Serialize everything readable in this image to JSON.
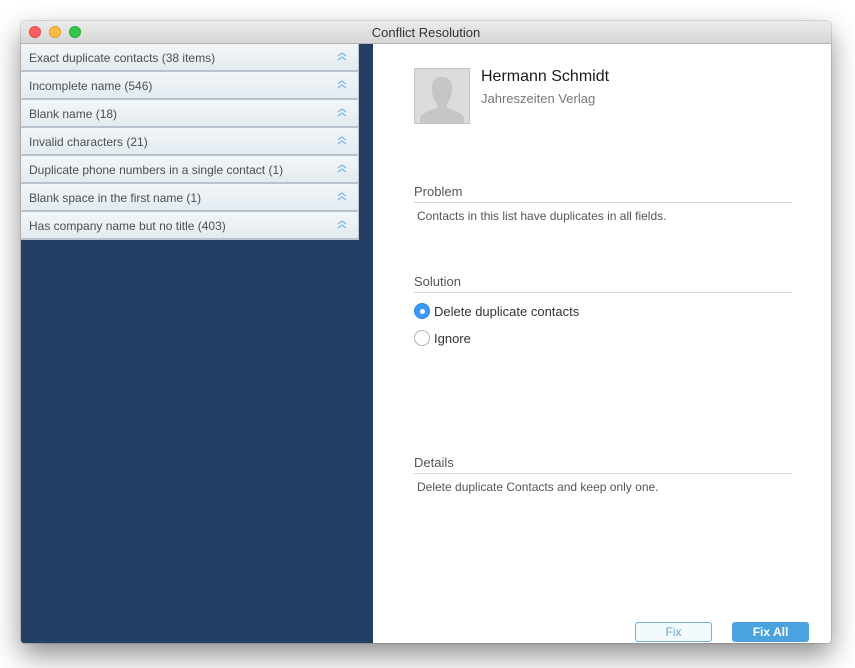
{
  "window": {
    "title": "Conflict Resolution",
    "traffic_lights": [
      "close",
      "minimize",
      "maximize"
    ]
  },
  "sidebar": {
    "background": "#243f63",
    "items": [
      {
        "label": "Exact duplicate contacts (38 items)",
        "icon": "double-chevron-up-icon"
      },
      {
        "label": "Incomplete name (546)",
        "icon": "double-chevron-up-icon"
      },
      {
        "label": "Blank name (18)",
        "icon": "double-chevron-up-icon"
      },
      {
        "label": "Invalid characters (21)",
        "icon": "double-chevron-up-icon"
      },
      {
        "label": "Duplicate phone numbers in a single contact (1)",
        "icon": "double-chevron-up-icon"
      },
      {
        "label": "Blank space in the first name (1)",
        "icon": "double-chevron-up-icon"
      },
      {
        "label": "Has company name but no title (403)",
        "icon": "double-chevron-up-icon"
      }
    ]
  },
  "contact": {
    "name": "Hermann Schmidt",
    "company": "Jahreszeiten Verlag",
    "avatar_icon": "person-silhouette-icon"
  },
  "problem": {
    "heading": "Problem",
    "text": "Contacts in this list have duplicates in all fields."
  },
  "solution": {
    "heading": "Solution",
    "options": [
      {
        "label": "Delete duplicate contacts",
        "selected": true
      },
      {
        "label": "Ignore",
        "selected": false
      }
    ]
  },
  "details": {
    "heading": "Details",
    "text": "Delete duplicate Contacts and keep only one."
  },
  "buttons": {
    "fix_label": "Fix",
    "fix_all_label": "Fix All",
    "accent": "#4aa3df"
  }
}
